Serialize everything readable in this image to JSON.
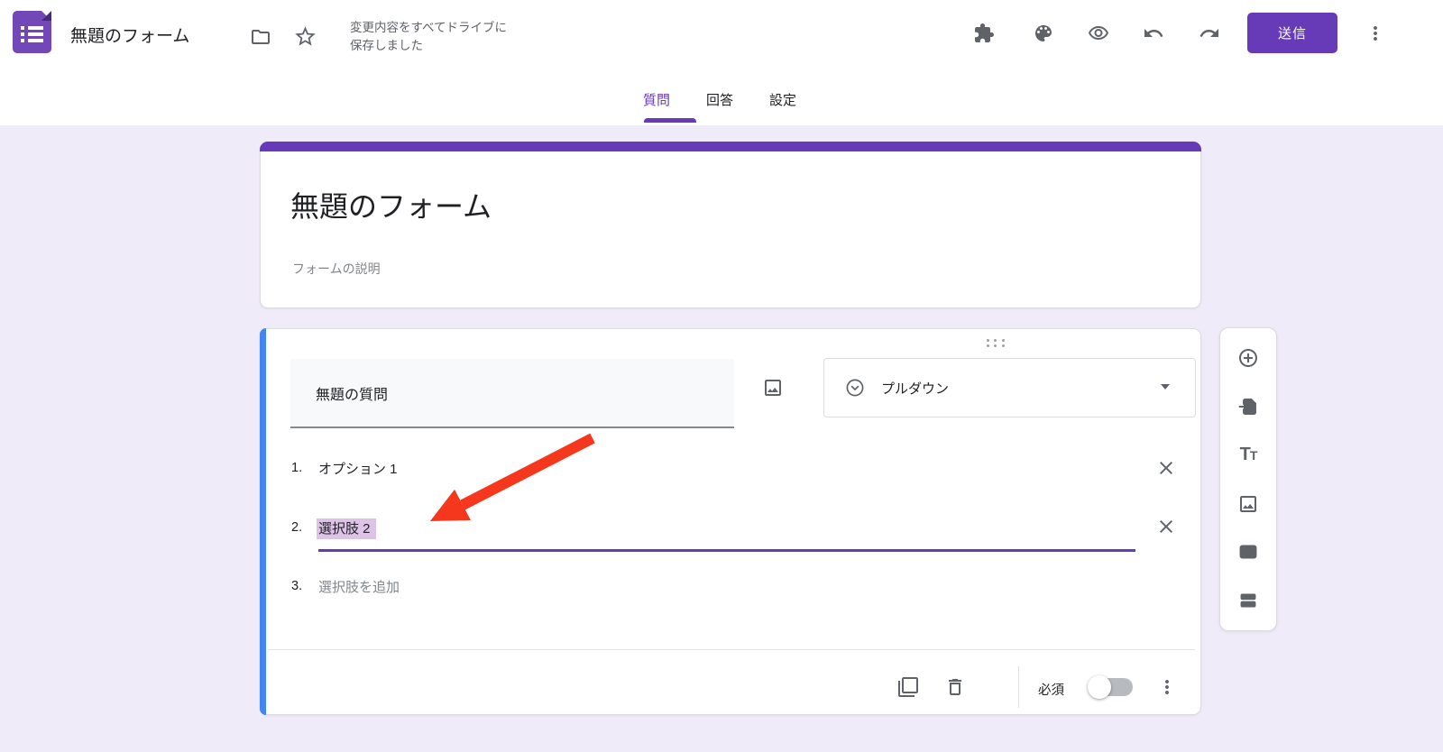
{
  "colors": {
    "accent_purple": "#673ab7",
    "active_card_blue": "#4285f4",
    "page_background": "#f0ebf8",
    "selection_highlight": "#ddc3e6",
    "arrow_red": "#f5371d"
  },
  "header": {
    "logo_icon": "forms-logo-icon",
    "title": "無題のフォーム",
    "folder_icon": "folder-icon",
    "star_icon": "star-icon",
    "save_status": "変更内容をすべてドライブに保存しました",
    "actions": {
      "addons_icon": "puzzle-addons-icon",
      "theme_icon": "palette-theme-icon",
      "preview_icon": "eye-preview-icon",
      "undo_icon": "undo-icon",
      "redo_icon": "redo-icon",
      "send_label": "送信",
      "more_icon": "kebab-menu-icon"
    }
  },
  "tabs": [
    {
      "label": "質問",
      "active": true
    },
    {
      "label": "回答",
      "active": false
    },
    {
      "label": "設定",
      "active": false
    }
  ],
  "form_header_card": {
    "title": "無題のフォーム",
    "description_placeholder": "フォームの説明"
  },
  "question_card": {
    "question_title": "無題の質問",
    "image_icon": "add-image-icon",
    "type_selector": {
      "label": "プルダウン",
      "icon": "dropdown-circle-icon",
      "caret": "caret-down-icon"
    },
    "options": [
      {
        "number": "1.",
        "label": "オプション 1",
        "state": "filled",
        "removable": true
      },
      {
        "number": "2.",
        "label": "選択肢 2",
        "state": "selected",
        "removable": true
      },
      {
        "number": "3.",
        "label": "選択肢を追加",
        "state": "placeholder",
        "removable": false
      }
    ],
    "footer": {
      "duplicate_icon": "duplicate-icon",
      "delete_icon": "trash-icon",
      "required_label": "必須",
      "required_toggle_on": false,
      "more_icon": "kebab-menu-icon"
    }
  },
  "side_toolbar_icons": [
    "add-question-icon",
    "import-questions-icon",
    "add-title-text-icon",
    "add-image-icon",
    "add-video-icon",
    "add-section-icon"
  ],
  "annotation": {
    "type": "red-arrow",
    "points_to": "選択肢 2"
  }
}
